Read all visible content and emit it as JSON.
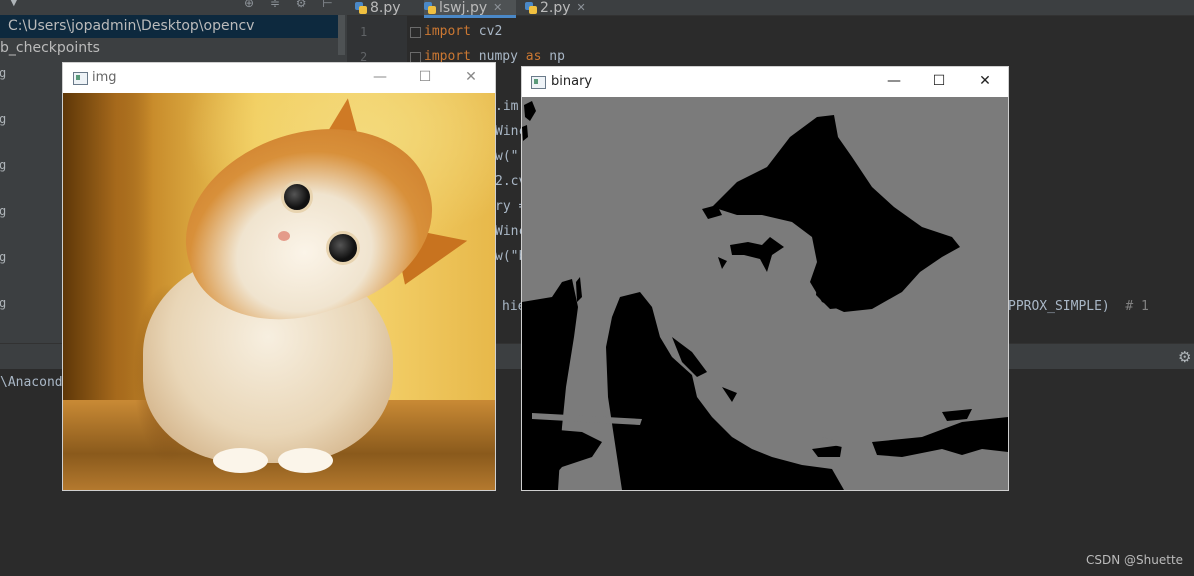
{
  "ide": {
    "explorer": {
      "path": "C:\\Users\\jopadmin\\Desktop\\opencv",
      "folder": "b_checkpoints",
      "file_glyph": "g"
    },
    "tabs": [
      {
        "label": "8.py",
        "active": false
      },
      {
        "label": "lswj.py",
        "active": true
      },
      {
        "label": "2.py",
        "active": false
      }
    ],
    "line_numbers": [
      "1",
      "2"
    ],
    "code": {
      "line1_kw": "import",
      "line1_rest": " cv2",
      "line2_kw": "import",
      "line2_mid": " numpy ",
      "line2_kw2": "as",
      "line2_rest": " np",
      "frag1": ".im",
      "frag2": "Winc",
      "frag3": "w(\"",
      "frag4": "2.cv",
      "frag5": "ry =",
      "frag6": "Winc",
      "frag7": "w(\"b",
      "frag8": "hie",
      "frag9": "PPROX_SIMPLE)",
      "frag9_comment": "  # 1"
    },
    "console": "\\Anacond",
    "watermark": "CSDN @Shuette"
  },
  "windows": {
    "img": {
      "title": "img",
      "minimize": "—",
      "maximize": "☐",
      "close": "✕"
    },
    "binary": {
      "title": "binary",
      "minimize": "—",
      "maximize": "☐",
      "close": "✕"
    }
  },
  "colors": {
    "binary_gray": "#7b7b7b",
    "binary_black": "#000000"
  }
}
